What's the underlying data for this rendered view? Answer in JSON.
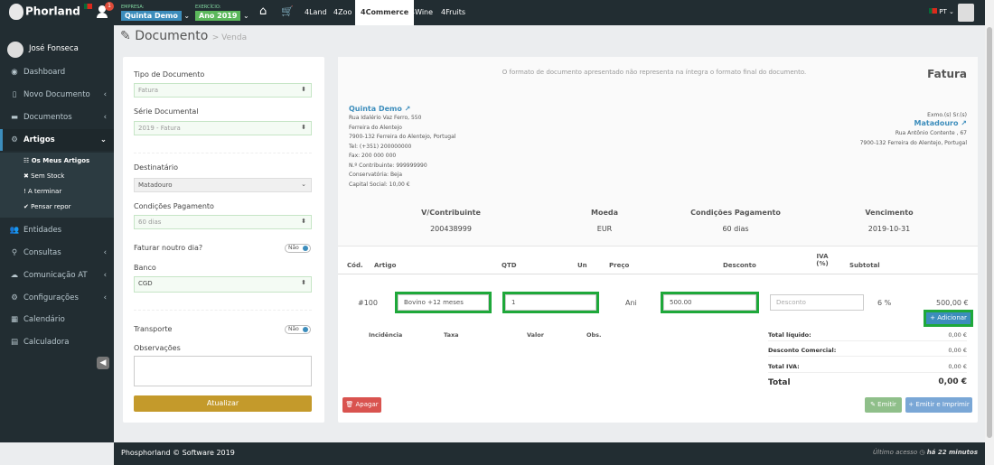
{
  "topbar": {
    "logo": "Phorland",
    "notifications": "1",
    "empresa_label": "EMPRESA:",
    "empresa_value": "Quinta Demo",
    "exercicio_label": "EXERCÍCIO:",
    "exercicio_value": "Ano 2019",
    "apps": [
      "4Land",
      "4Zoo",
      "4Commerce",
      "4Wine",
      "4Fruits"
    ],
    "active_app": "4Commerce",
    "language": "PT"
  },
  "sidebar": {
    "user": "José Fonseca",
    "items": [
      "Dashboard",
      "Novo Documento",
      "Documentos",
      "Artigos",
      "Entidades",
      "Consultas",
      "Comunicação AT",
      "Configurações",
      "Calendário",
      "Calculadora"
    ],
    "artigos_sub": [
      "Os Meus Artigos",
      "Sem Stock",
      "A terminar",
      "Pensar repor"
    ]
  },
  "page": {
    "title": "Documento",
    "subtitle": "> Venda"
  },
  "form": {
    "tipo_label": "Tipo de Documento",
    "tipo_value": "Fatura",
    "serie_label": "Série Documental",
    "serie_value": "2019 - Fatura",
    "dest_label": "Destinatário",
    "dest_value": "Matadouro",
    "cond_label": "Condições Pagamento",
    "cond_value": "60 dias",
    "faturar_label": "Faturar noutro dia?",
    "faturar_toggle": "Não",
    "banco_label": "Banco",
    "banco_value": "CGD",
    "transp_label": "Transporte",
    "transp_toggle": "Não",
    "obs_label": "Observações",
    "update_btn": "Atualizar"
  },
  "doc": {
    "notice": "O formato de documento apresentado não representa na íntegra o formato final do documento.",
    "type": "Fatura",
    "company": {
      "name": "Quinta Demo",
      "lines": [
        "Rua Idalério Vaz Ferro, 550",
        "Ferreira do Alentejo",
        "7900-132 Ferreira do Alentejo, Portugal",
        "Tel: (+351) 200000000",
        "Fax: 200 000 000",
        "N.º Contribuinte: 999999990",
        "Conservatória: Beja",
        "Capital Social: 10,00 €"
      ]
    },
    "customer": {
      "salutation": "Exmo.(s) Sr.(s)",
      "name": "Matadouro",
      "lines": [
        "Rua Antônio Contente , 67",
        "7900-132 Ferreira do Alentejo, Portugal"
      ]
    },
    "meta": {
      "headers": [
        "V/Contribuinte",
        "Moeda",
        "Condições Pagamento",
        "Vencimento"
      ],
      "values": [
        "200438999",
        "EUR",
        "60 dias",
        "2019-10-31"
      ]
    },
    "table": {
      "headers": [
        "Cód.",
        "Artigo",
        "QTD",
        "Un",
        "Preço",
        "Desconto",
        "IVA (%)",
        "Subtotal"
      ],
      "row": {
        "code": "#100",
        "article": "Bovino +12 meses",
        "qty": "1",
        "unit": "Ani",
        "price": "500.00",
        "discount_placeholder": "Desconto",
        "vat": "6 %",
        "subtotal": "500,00 €"
      }
    },
    "add_btn": "Adicionar",
    "vat_headers": [
      "Incidência",
      "Taxa",
      "Valor",
      "Obs."
    ],
    "totals": [
      {
        "label": "Total líquido:",
        "value": "0,00 €"
      },
      {
        "label": "Desconto Comercial:",
        "value": "0,00 €"
      },
      {
        "label": "Total IVA:",
        "value": "0,00 €"
      }
    ],
    "total_label": "Total",
    "total_value": "0,00 €",
    "delete_btn": "Apagar",
    "emit_btn": "Emitir",
    "emit_print_btn": "Emitir e Imprimir"
  },
  "footer": {
    "left": "Phosphorland © Software 2019",
    "right_prefix": "Último acesso",
    "right_time": "há 22 minutos"
  },
  "colors": {
    "sidebar": "#222d32",
    "accent": "#3c8dbc",
    "update": "#c49a2b",
    "highlight": "#1ea83a",
    "danger": "#d9534f"
  }
}
